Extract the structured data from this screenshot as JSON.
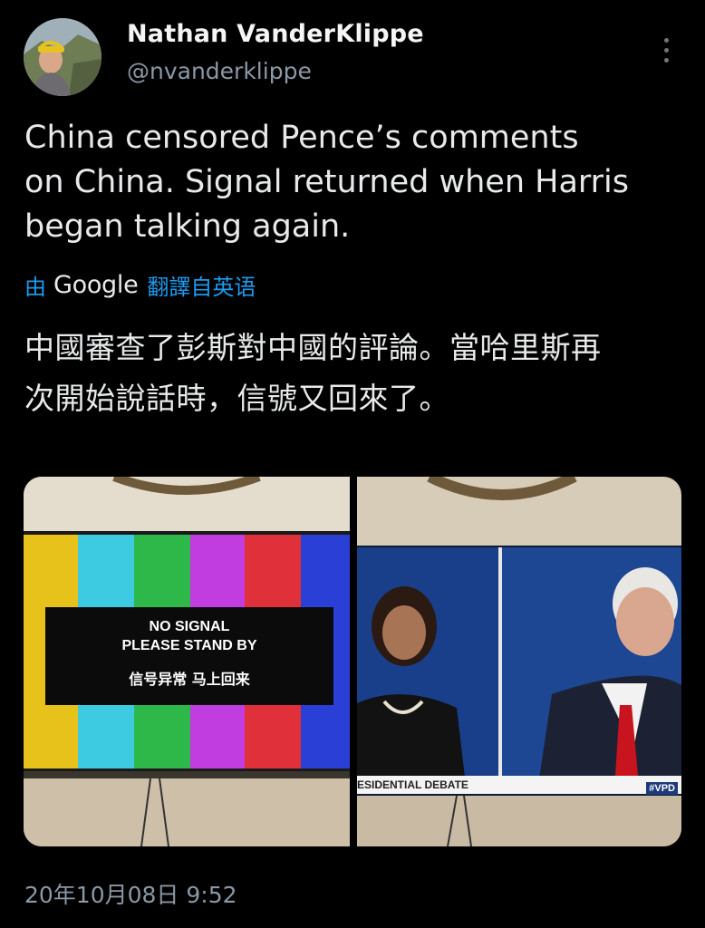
{
  "author": {
    "name": "Nathan VanderKlippe",
    "handle": "@nvanderklippe",
    "avatar_icon": "avatar-photo"
  },
  "tweet": {
    "text": "China censored Pence’s comments\non China. Signal returned when Harris\nbegan talking again.",
    "translation_by": "由",
    "translation_service": "Google",
    "translated_from": "翻譯自英语",
    "translated_text": "中國審查了彭斯對中國的評論。當哈里斯再\n次開始說話時，信號又回來了。",
    "timestamp": "20年10月08日 9:52"
  },
  "media": {
    "left_image": {
      "line1": "NO SIGNAL",
      "line2": "PLEASE STAND BY",
      "line3": "信号异常 马上回来"
    },
    "right_image": {
      "lower_third": "ESIDENTIAL DEBATE",
      "hashtag": "#VPD"
    }
  },
  "colors": {
    "background": "#000000",
    "link": "#1d9bf0",
    "secondary_text": "#8b98a5"
  }
}
